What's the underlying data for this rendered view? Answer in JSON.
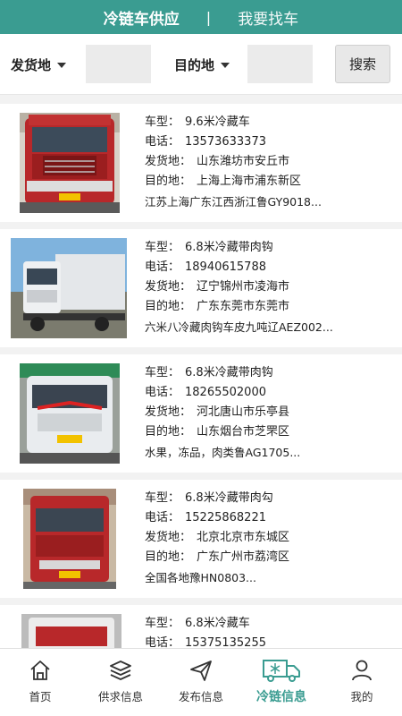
{
  "header": {
    "tab_active": "冷链车供应",
    "separator": "|",
    "tab_other": "我要找车"
  },
  "filter": {
    "origin_label": "发货地",
    "dest_label": "目的地",
    "search_label": "搜索"
  },
  "field_labels": {
    "type": "车型：",
    "phone": "电话：",
    "origin": "发货地：",
    "dest": "目的地："
  },
  "listings": [
    {
      "type": "9.6米冷藏车",
      "phone": "13573633373",
      "origin": "山东潍坊市安丘市",
      "dest": "上海上海市浦东新区",
      "desc": "江苏上海广东江西浙江鲁GY9018..."
    },
    {
      "type": "6.8米冷藏带肉钩",
      "phone": "18940615788",
      "origin": "辽宁锦州市凌海市",
      "dest": "广东东莞市东莞市",
      "desc": "六米八冷藏肉钩车皮九吨辽AEZ002..."
    },
    {
      "type": "6.8米冷藏带肉钩",
      "phone": "18265502000",
      "origin": "河北唐山市乐亭县",
      "dest": "山东烟台市芝罘区",
      "desc": "水果，冻品，肉类鲁AG1705..."
    },
    {
      "type": "6.8米冷藏带肉勾",
      "phone": "15225868221",
      "origin": "北京北京市东城区",
      "dest": "广东广州市荔湾区",
      "desc": "全国各地豫HN0803..."
    },
    {
      "type": "6.8米冷藏车",
      "phone": "15375135255",
      "origin": "",
      "dest": "",
      "desc": ""
    }
  ],
  "tabbar": [
    {
      "label": "首页",
      "icon": "home-icon"
    },
    {
      "label": "供求信息",
      "icon": "layers-icon"
    },
    {
      "label": "发布信息",
      "icon": "send-icon"
    },
    {
      "label": "冷链信息",
      "icon": "coldchain-truck-icon"
    },
    {
      "label": "我的",
      "icon": "user-icon"
    }
  ],
  "colors": {
    "accent": "#3a9c91",
    "cab_red": "#b8282a",
    "cab_white": "#e9ecef"
  }
}
